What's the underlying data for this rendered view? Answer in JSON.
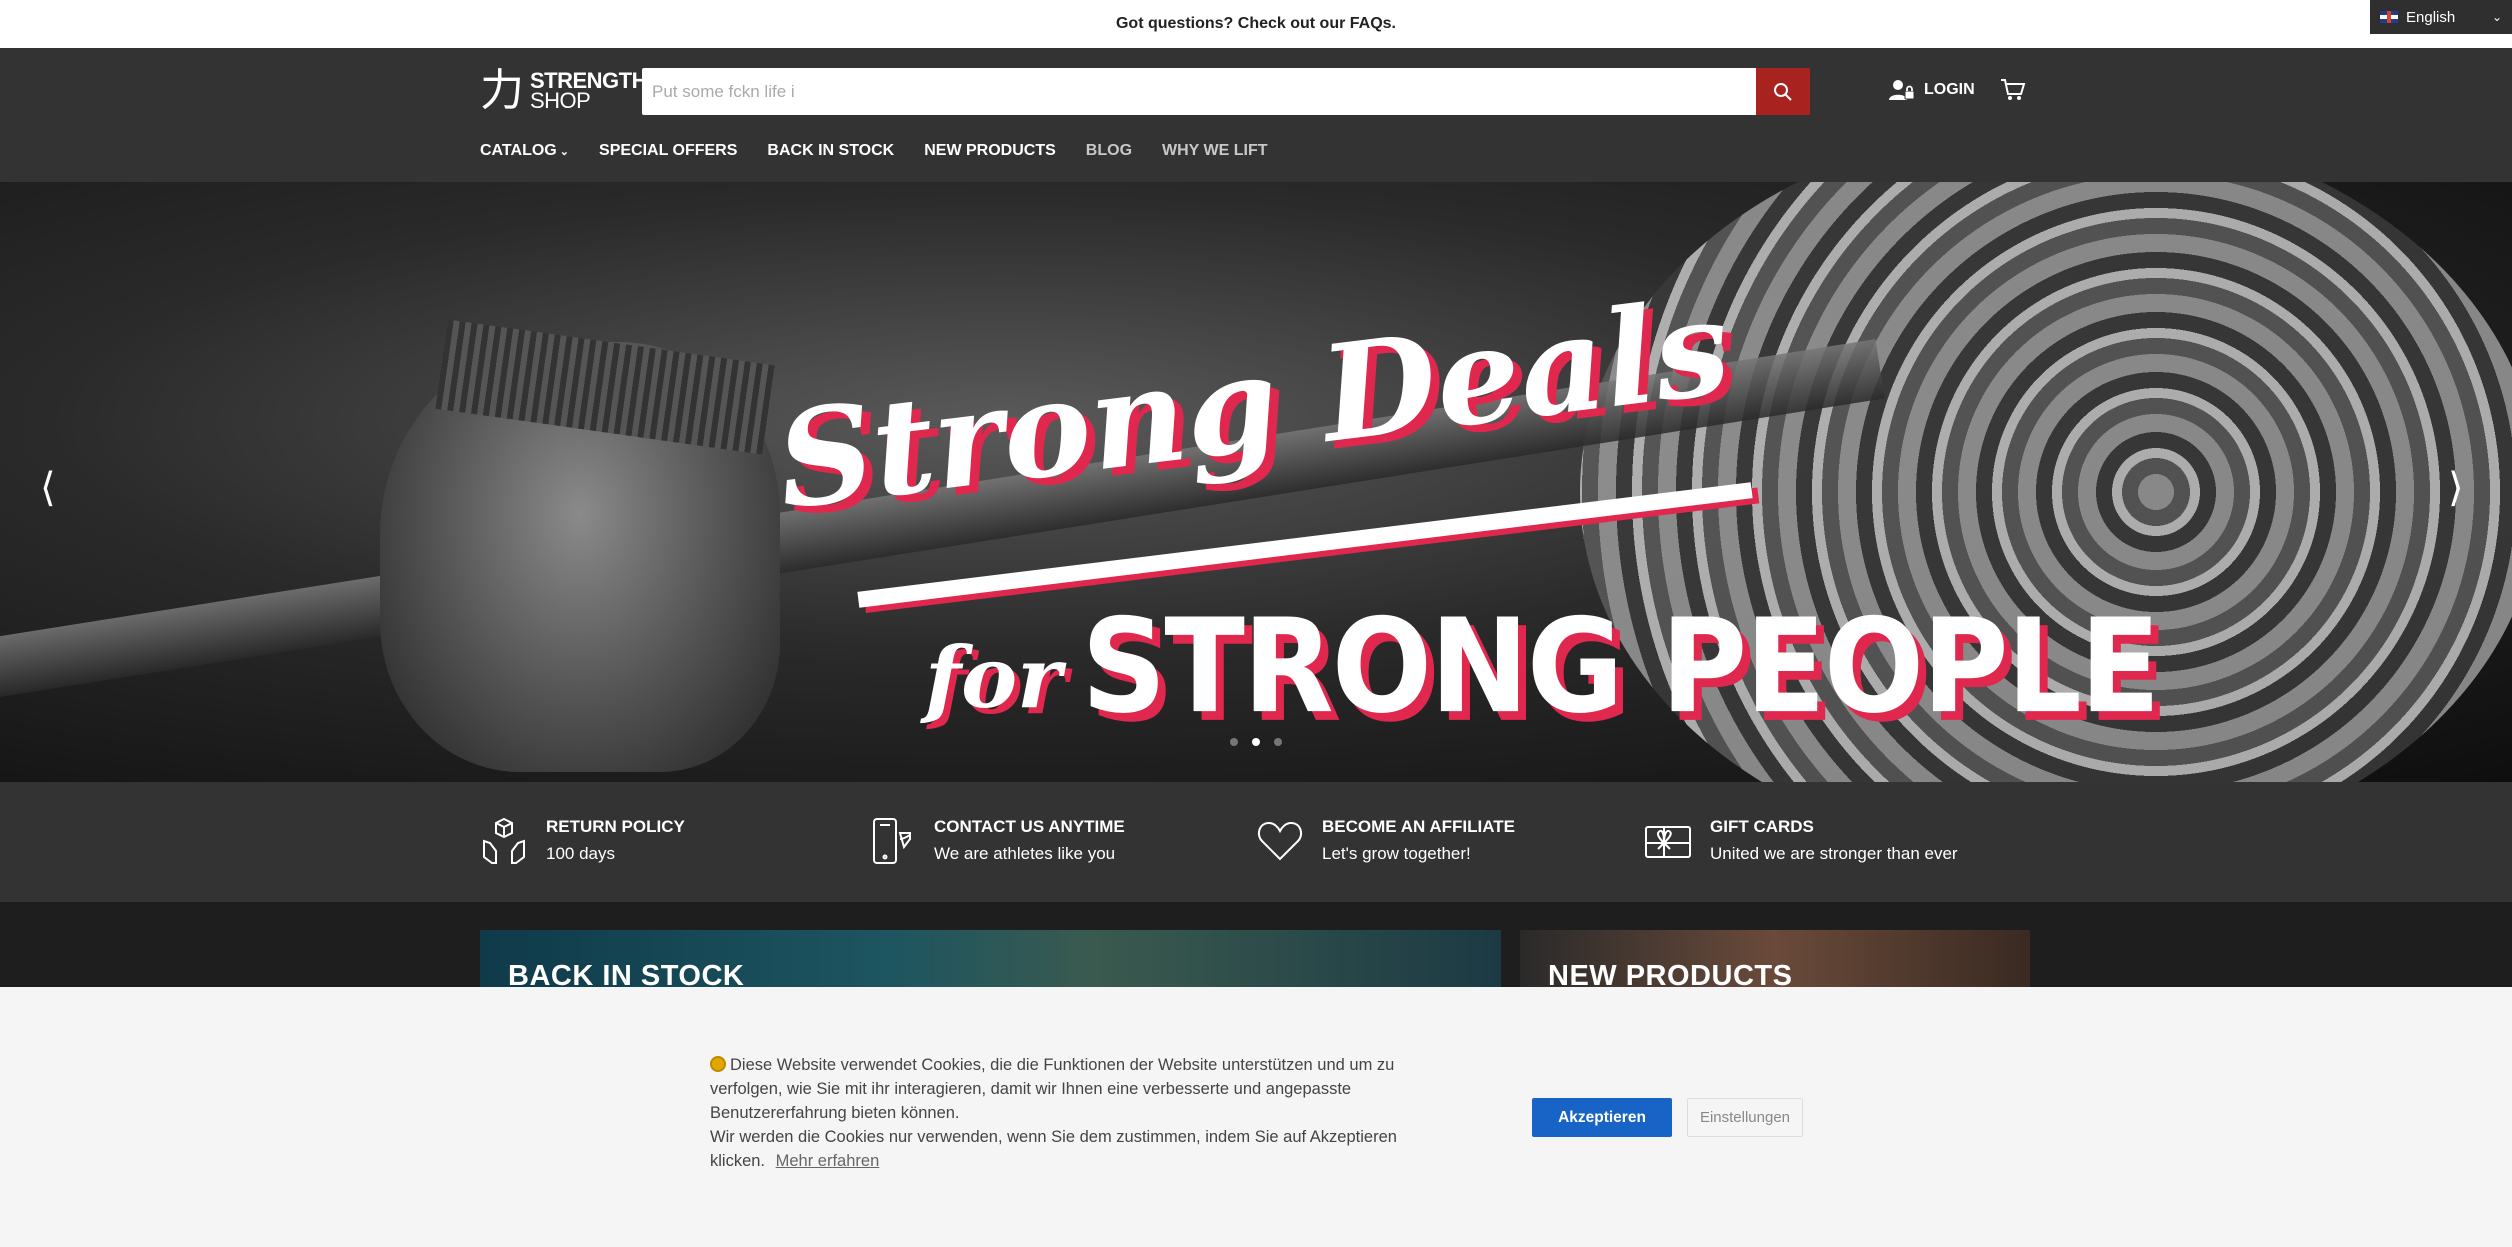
{
  "announcement": "Got questions? Check out our FAQs.",
  "language": {
    "selected": "English",
    "flag_icon": "uk-flag-icon"
  },
  "header": {
    "logo_line1": "STRENGTH",
    "logo_line2": "SHOP",
    "logo_glyph": "力",
    "search_placeholder": "Put some fckn life i",
    "login_label": "LOGIN"
  },
  "nav": [
    {
      "label": "CATALOG",
      "has_dropdown": true
    },
    {
      "label": "SPECIAL OFFERS"
    },
    {
      "label": "BACK IN STOCK"
    },
    {
      "label": "NEW PRODUCTS"
    },
    {
      "label": "BLOG"
    },
    {
      "label": "WHY WE LIFT"
    }
  ],
  "hero": {
    "headline_line1": "Strong Deals",
    "headline_for": "for",
    "headline_line2": "STRONG PEOPLE",
    "slide_count": 3,
    "active_slide": 2,
    "accent_color": "#e0284f"
  },
  "features": [
    {
      "title": "RETURN POLICY",
      "subtitle": "100 days",
      "icon": "box-hands-icon"
    },
    {
      "title": "CONTACT US ANYTIME",
      "subtitle": "We are athletes like you",
      "icon": "phone-icon"
    },
    {
      "title": "BECOME AN AFFILIATE",
      "subtitle": "Let's grow together!",
      "icon": "heart-icon"
    },
    {
      "title": "GIFT CARDS",
      "subtitle": "United we are stronger than ever",
      "icon": "gift-card-icon"
    }
  ],
  "tiles": [
    {
      "title": "BACK IN STOCK"
    },
    {
      "title": "NEW PRODUCTS"
    }
  ],
  "cookie": {
    "text_line1": "Diese Website verwendet Cookies, die die Funktionen der Website unterstützen und um zu verfolgen, wie Sie mit ihr interagieren, damit wir Ihnen eine verbesserte und angepasste Benutzererfahrung bieten können.",
    "text_line2": "Wir werden die Cookies nur verwenden, wenn Sie dem zustimmen, indem Sie auf Akzeptieren klicken.",
    "learn_more": "Mehr erfahren",
    "accept_label": "Akzeptieren",
    "settings_label": "Einstellungen"
  },
  "colors": {
    "brand_red": "#a8231f",
    "accept_blue": "#1863c6",
    "header_bg": "#333333"
  }
}
